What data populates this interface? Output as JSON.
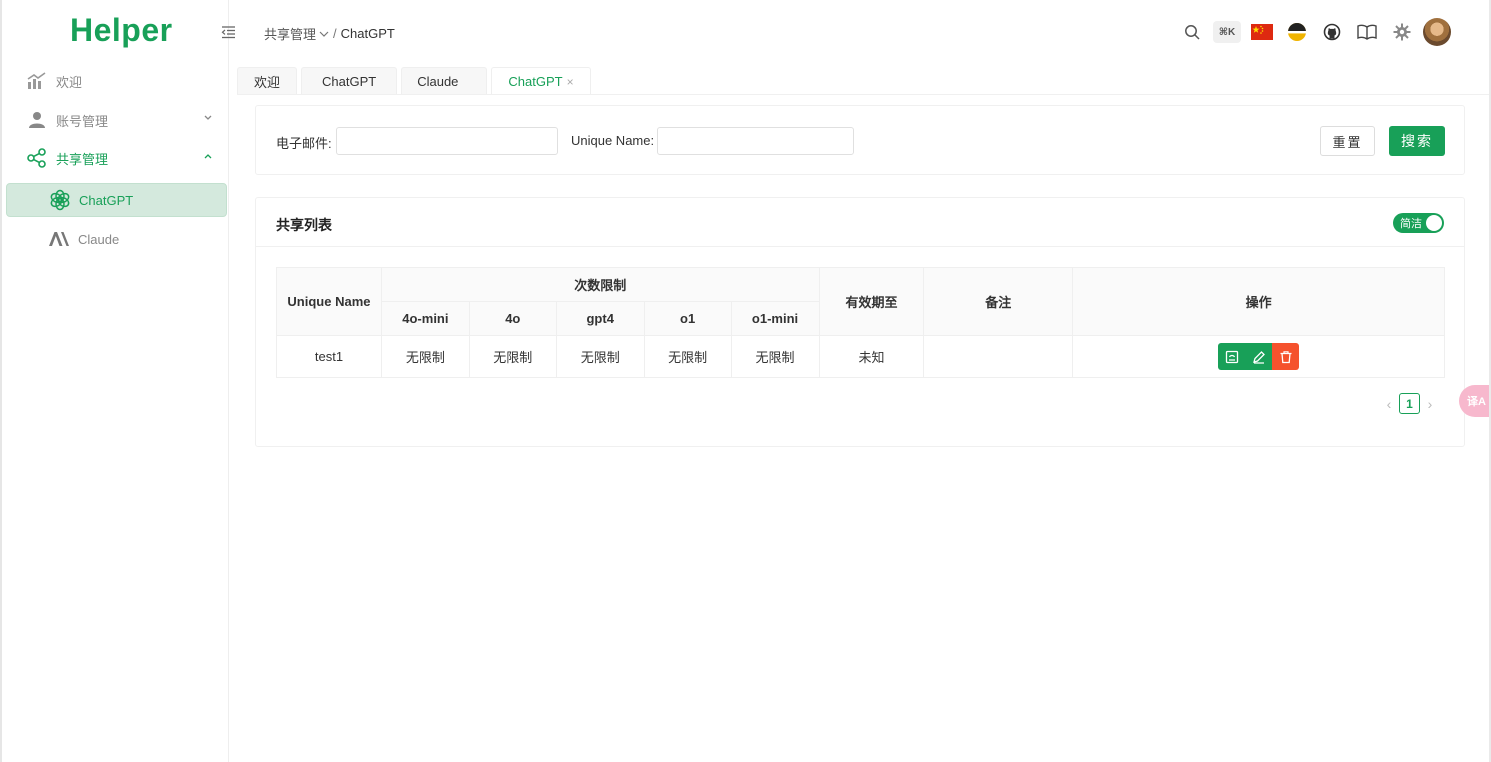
{
  "app": {
    "logo": "Helper",
    "brand_color": "#18a058",
    "danger_color": "#f5522d"
  },
  "sidebar": {
    "items": [
      {
        "label": "欢迎",
        "icon": "chart-trend-icon"
      },
      {
        "label": "账号管理",
        "icon": "user-icon"
      },
      {
        "label": "共享管理",
        "icon": "share-icon"
      },
      {
        "label": "ChatGPT",
        "icon": "openai-icon"
      },
      {
        "label": "Claude",
        "icon": "anthropic-icon"
      }
    ]
  },
  "header": {
    "breadcrumb": {
      "parent": "共享管理",
      "separator": "/",
      "current": "ChatGPT"
    },
    "shortcut": "⌘K"
  },
  "tabs": [
    {
      "label": "欢迎"
    },
    {
      "label": "ChatGPT"
    },
    {
      "label": "Claude"
    },
    {
      "label": "ChatGPT",
      "close": "×"
    }
  ],
  "filter": {
    "email_label": "电子邮件:",
    "email_value": "",
    "unique_name_label": "Unique Name:",
    "unique_name_value": "",
    "reset_label": "重置",
    "search_label": "搜索"
  },
  "list": {
    "title": "共享列表",
    "toggle_label": "简洁",
    "columns": {
      "unique_name": "Unique Name",
      "limit_group": "次数限制",
      "limits": [
        "4o-mini",
        "4o",
        "gpt4",
        "o1",
        "o1-mini"
      ],
      "expires": "有效期至",
      "remark": "备注",
      "actions": "操作"
    },
    "rows": [
      {
        "unique_name": "test1",
        "limits": [
          "无限制",
          "无限制",
          "无限制",
          "无限制",
          "无限制"
        ],
        "expires": "未知",
        "remark": ""
      }
    ]
  },
  "pagination": {
    "prev": "‹",
    "current": "1",
    "next": "›"
  },
  "fab": {
    "label": "译A"
  }
}
